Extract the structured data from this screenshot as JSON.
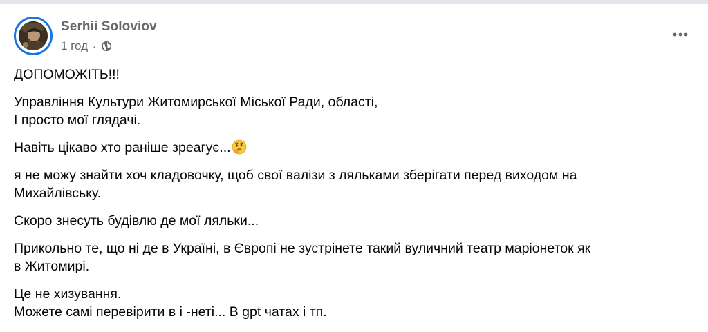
{
  "post": {
    "author": "Serhii Soloviov",
    "timestamp": "1 год",
    "separator": "·",
    "privacy_icon": "globe-icon",
    "more_icon": "more-horizontal-icon",
    "paragraphs": [
      {
        "lines": [
          "ДОПОМОЖІТЬ!!!"
        ]
      },
      {
        "lines": [
          "Управління Культури Житомирської Міської Ради, області,",
          "І просто мої глядачі."
        ]
      },
      {
        "lines": [
          "Навіть цікаво хто раніше зреагує..."
        ],
        "emoji": "thinking-face-icon"
      },
      {
        "lines": [
          "я не можу знайти хоч кладовочку, щоб свої валізи з ляльками зберігати перед виходом на",
          "Михайлівську."
        ]
      },
      {
        "lines": [
          "Скоро знесуть будівлю де мої ляльки..."
        ]
      },
      {
        "lines": [
          "Прикольно те, що ні де в Україні, в Європі не зустрінете такий вуличний театр маріонеток як",
          "в Житомирі."
        ]
      },
      {
        "lines": [
          "Це не хизування.",
          "Можете самі перевірити в і -неті... В gpt чатах і тп."
        ]
      }
    ]
  },
  "colors": {
    "accent_ring": "#1b74e4",
    "secondary_text": "#65676b",
    "primary_text": "#050505"
  }
}
